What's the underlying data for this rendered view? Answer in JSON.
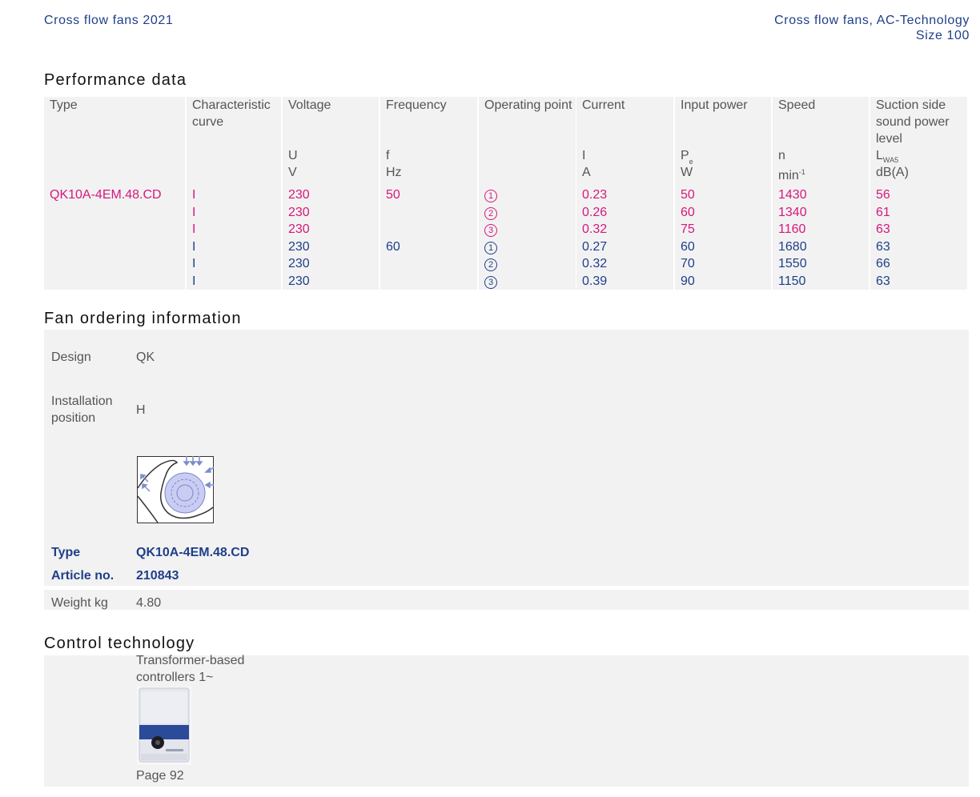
{
  "header": {
    "left": "Cross flow fans 2021",
    "right_line1": "Cross flow fans, AC-Technology",
    "right_line2": "Size 100"
  },
  "performance": {
    "title": "Performance data",
    "columns": {
      "type": "Type",
      "curve": "Characteristic curve",
      "voltage": "Voltage",
      "voltage_sym": "U",
      "voltage_unit": "V",
      "frequency": "Frequency",
      "frequency_sym": "f",
      "frequency_unit": "Hz",
      "op_point": "Operating point",
      "current": "Current",
      "current_sym": "I",
      "current_unit": "A",
      "power": "Input power",
      "power_sym": "P",
      "power_sub": "e",
      "power_unit": "W",
      "speed": "Speed",
      "speed_sym": "n",
      "speed_unit": "min",
      "speed_sup": "-1",
      "sound": "Suction side sound power level",
      "sound_sym": "L",
      "sound_sub": "WA5",
      "sound_unit": "dB(A)"
    },
    "rows": [
      {
        "type": "QK10A-4EM.48.CD",
        "curve": "I",
        "voltage": "230",
        "frequency": "50",
        "op": "1",
        "current": "0.23",
        "power": "50",
        "speed": "1430",
        "sound": "56"
      },
      {
        "type": "",
        "curve": "I",
        "voltage": "230",
        "frequency": "",
        "op": "2",
        "current": "0.26",
        "power": "60",
        "speed": "1340",
        "sound": "61"
      },
      {
        "type": "",
        "curve": "I",
        "voltage": "230",
        "frequency": "",
        "op": "3",
        "current": "0.32",
        "power": "75",
        "speed": "1160",
        "sound": "63"
      },
      {
        "type": "",
        "curve": "I",
        "voltage": "230",
        "frequency": "60",
        "op": "1",
        "current": "0.27",
        "power": "60",
        "speed": "1680",
        "sound": "63"
      },
      {
        "type": "",
        "curve": "I",
        "voltage": "230",
        "frequency": "",
        "op": "2",
        "current": "0.32",
        "power": "70",
        "speed": "1550",
        "sound": "66"
      },
      {
        "type": "",
        "curve": "I",
        "voltage": "230",
        "frequency": "",
        "op": "3",
        "current": "0.39",
        "power": "90",
        "speed": "1150",
        "sound": "63"
      }
    ]
  },
  "ordering": {
    "title": "Fan ordering information",
    "design_label": "Design",
    "design_value": "QK",
    "install_label1": "Installation",
    "install_label2": "position",
    "install_value": "H",
    "type_label": "Type",
    "type_value": "QK10A-4EM.48.CD",
    "article_label": "Article no.",
    "article_value": "210843",
    "weight_label": "Weight kg",
    "weight_value": "4.80"
  },
  "control": {
    "title": "Control technology",
    "line1": "Transformer-based",
    "line2": "controllers 1~",
    "page": "Page 92"
  },
  "colors": {
    "blue": "#1f3f8a",
    "pink": "#d6187d",
    "panel": "#f2f2f2"
  }
}
